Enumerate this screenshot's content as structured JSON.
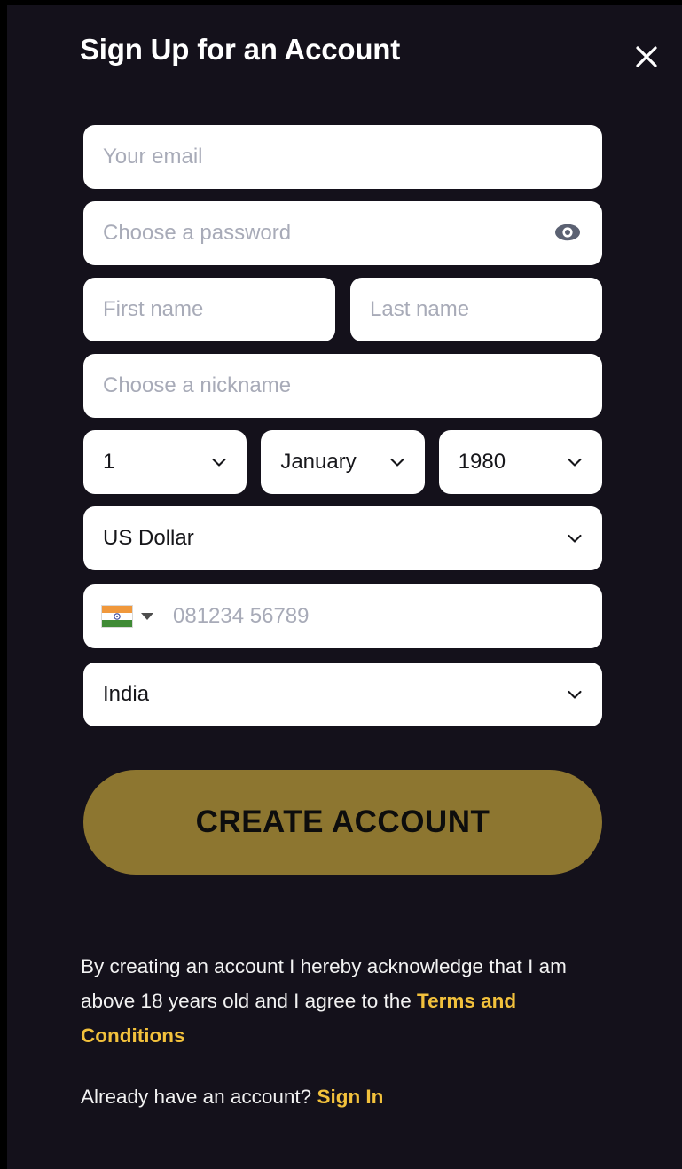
{
  "modal": {
    "title": "Sign Up for an Account",
    "close_icon": "close-icon",
    "background_color": "#14111b"
  },
  "form": {
    "email": {
      "placeholder": "Your email",
      "value": ""
    },
    "password": {
      "placeholder": "Choose a password",
      "value": "",
      "toggle_icon": "eye-icon"
    },
    "first_name": {
      "placeholder": "First name",
      "value": ""
    },
    "last_name": {
      "placeholder": "Last name",
      "value": ""
    },
    "nickname": {
      "placeholder": "Choose a nickname",
      "value": ""
    },
    "birth_day": {
      "value": "1",
      "icon": "chevron-down-icon"
    },
    "birth_month": {
      "value": "January",
      "icon": "chevron-down-icon"
    },
    "birth_year": {
      "value": "1980",
      "icon": "chevron-down-icon"
    },
    "currency": {
      "value": "US Dollar",
      "icon": "chevron-down-icon"
    },
    "phone": {
      "placeholder": "081234 56789",
      "value": "",
      "flag_icon": "india-flag-icon",
      "caret_icon": "caret-down-icon"
    },
    "country": {
      "value": "India",
      "icon": "chevron-down-icon"
    }
  },
  "actions": {
    "create_account_label": "CREATE ACCOUNT",
    "button_color": "#8d7630"
  },
  "footer": {
    "legal_text_before": "By creating an account I hereby acknowledge that I am above 18 years old and I agree to the ",
    "terms_link": "Terms and Conditions",
    "signin_prompt": "Already have an account? ",
    "signin_link": "Sign In",
    "accent_color": "#f2c13c"
  }
}
